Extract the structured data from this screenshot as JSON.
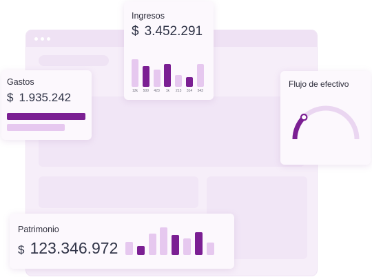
{
  "colors": {
    "accent": "#7b1f93",
    "light": "#e6c8ef",
    "card_bg": "#fcf8fd"
  },
  "ingresos": {
    "title": "Ingresos",
    "currency": "$",
    "amount": "3.452.291",
    "bars": [
      {
        "label": "12k",
        "level": 0.65,
        "dark": false
      },
      {
        "label": "500",
        "level": 0.48,
        "dark": true
      },
      {
        "label": "423",
        "level": 0.4,
        "dark": false
      },
      {
        "label": "1k",
        "level": 0.54,
        "dark": true
      },
      {
        "label": "213",
        "level": 0.28,
        "dark": false
      },
      {
        "label": "314",
        "level": 0.22,
        "dark": true
      },
      {
        "label": "543",
        "level": 0.53,
        "dark": false
      }
    ]
  },
  "gastos": {
    "title": "Gastos",
    "currency": "$",
    "amount": "1.935.242",
    "bars": [
      {
        "level": 1.0,
        "dark": true
      },
      {
        "level": 0.74,
        "dark": false
      }
    ]
  },
  "flujo": {
    "title": "Flujo de efectivo",
    "gauge_value": 0.25
  },
  "patrimonio": {
    "title": "Patrimonio",
    "currency": "$",
    "amount": "123.346.972",
    "bars": [
      {
        "level": 0.47,
        "dark": false
      },
      {
        "level": 0.33,
        "dark": true
      },
      {
        "level": 0.77,
        "dark": false
      },
      {
        "level": 1.0,
        "dark": false
      },
      {
        "level": 0.73,
        "dark": true
      },
      {
        "level": 0.6,
        "dark": false
      },
      {
        "level": 0.83,
        "dark": true
      },
      {
        "level": 0.45,
        "dark": false
      }
    ]
  }
}
